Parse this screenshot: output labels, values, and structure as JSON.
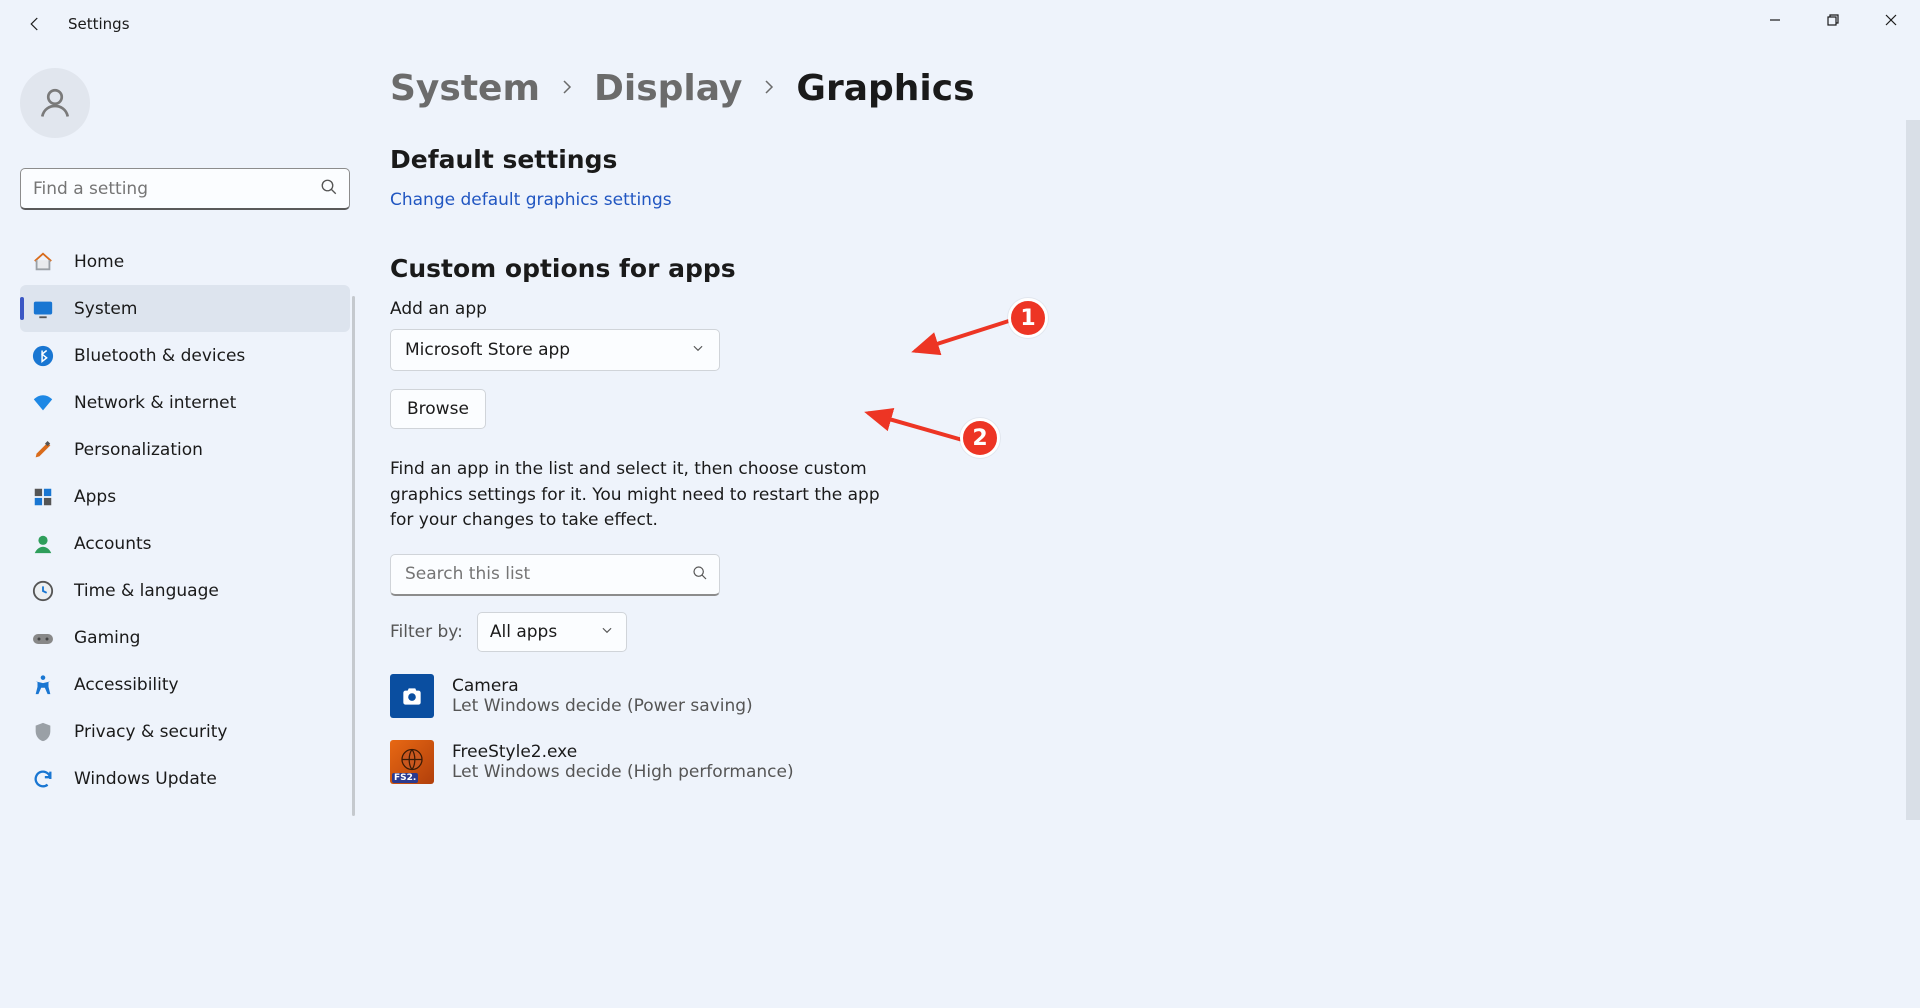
{
  "window": {
    "title": "Settings"
  },
  "search": {
    "placeholder": "Find a setting"
  },
  "nav": {
    "items": [
      {
        "label": "Home",
        "active": false
      },
      {
        "label": "System",
        "active": true
      },
      {
        "label": "Bluetooth & devices",
        "active": false
      },
      {
        "label": "Network & internet",
        "active": false
      },
      {
        "label": "Personalization",
        "active": false
      },
      {
        "label": "Apps",
        "active": false
      },
      {
        "label": "Accounts",
        "active": false
      },
      {
        "label": "Time & language",
        "active": false
      },
      {
        "label": "Gaming",
        "active": false
      },
      {
        "label": "Accessibility",
        "active": false
      },
      {
        "label": "Privacy & security",
        "active": false
      },
      {
        "label": "Windows Update",
        "active": false
      }
    ]
  },
  "breadcrumb": {
    "a": "System",
    "b": "Display",
    "c": "Graphics"
  },
  "sections": {
    "default_title": "Default settings",
    "default_link": "Change default graphics settings",
    "custom_title": "Custom options for apps",
    "add_label": "Add an app",
    "add_dropdown": "Microsoft Store app",
    "browse": "Browse",
    "help": "Find an app in the list and select it, then choose custom graphics settings for it. You might need to restart the app for your changes to take effect.",
    "list_search_placeholder": "Search this list",
    "filter_label": "Filter by:",
    "filter_value": "All apps"
  },
  "apps": [
    {
      "name": "Camera",
      "sub": "Let Windows decide (Power saving)",
      "icon_bg": "#0a4ea0"
    },
    {
      "name": "FreeStyle2.exe",
      "sub": "Let Windows decide (High performance)",
      "icon_bg": "#e86813"
    }
  ],
  "annotations": {
    "one": "1",
    "two": "2"
  }
}
